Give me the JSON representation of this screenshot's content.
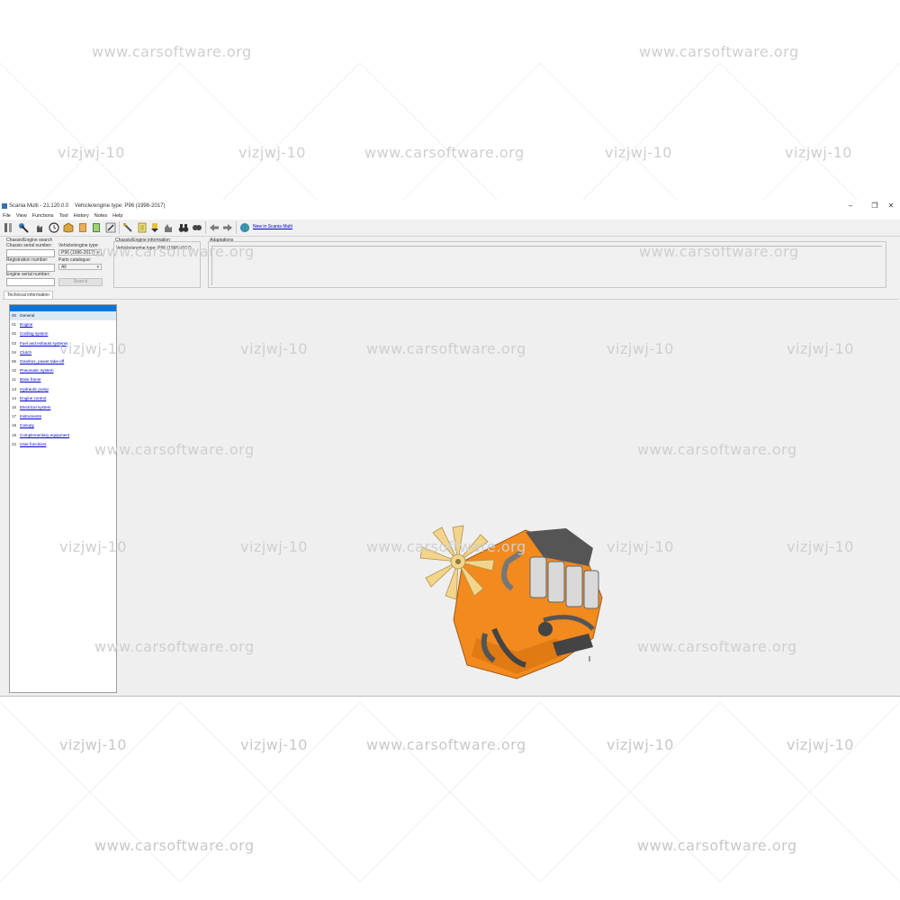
{
  "watermarks": {
    "site": "www.carsoftware.org",
    "code": "vizjwj-10"
  },
  "window": {
    "title": "Scania Multi - 21.120.0.0",
    "vehicle_title": "Vehicle/engine type: P96 (1996-2017)",
    "controls": [
      "–",
      "❐",
      "✕"
    ]
  },
  "menu": [
    "File",
    "View",
    "Functions",
    "Tool",
    "History",
    "Notes",
    "Help"
  ],
  "toolbar": {
    "icons": [
      "tools-icon",
      "wrench-icon",
      "hand-icon",
      "clock-icon",
      "box-icon",
      "book-icon",
      "book-green-icon",
      "edit-icon",
      "screwdriver-icon",
      "document-icon",
      "arrow-down-icon",
      "hand-tool-icon",
      "binoculars-icon",
      "search-icon",
      "back-arrow-icon",
      "forward-arrow-icon",
      "globe-icon"
    ],
    "link": "New in Scania Multi"
  },
  "search_panel": {
    "title": "Chassis/Engine search",
    "chassis_label": "Chassis serial number:",
    "chassis_value": "",
    "registration_label": "Registration number:",
    "registration_value": "",
    "engine_label": "Engine serial number:",
    "engine_value": "",
    "vehicle_type_label": "Vehicle/engine type:",
    "vehicle_type_value": "P96 (1996-2017)",
    "parts_label": "Parts catalogue:",
    "parts_value": "All",
    "search_button": "Search"
  },
  "info_panel": {
    "title": "Chassis/Engine information",
    "text": "Vehicle/engine type: P96 (1996-2017)"
  },
  "adaptations_panel": {
    "title": "Adaptations"
  },
  "tab": "Technical information",
  "tree": [
    {
      "num": "00",
      "label": "General"
    },
    {
      "num": "01",
      "label": "Engine"
    },
    {
      "num": "02",
      "label": "Cooling system"
    },
    {
      "num": "03",
      "label": "Fuel and exhaust systems"
    },
    {
      "num": "04",
      "label": "Clutch"
    },
    {
      "num": "05",
      "label": "Gearbox, power take-off"
    },
    {
      "num": "10",
      "label": "Pneumatic system"
    },
    {
      "num": "11",
      "label": "Base frame"
    },
    {
      "num": "13",
      "label": "Hydraulic pump"
    },
    {
      "num": "14",
      "label": "Engine control"
    },
    {
      "num": "16",
      "label": "Electrical system"
    },
    {
      "num": "17",
      "label": "Instruments"
    },
    {
      "num": "18",
      "label": "Canopy"
    },
    {
      "num": "19",
      "label": "Complementary equipment"
    },
    {
      "num": "22",
      "label": "User functions"
    }
  ],
  "colors": {
    "selection": "#0a74d9",
    "link": "#0000cc",
    "engine_orange": "#f28a1e",
    "fan_yellow": "#f2d58a"
  }
}
